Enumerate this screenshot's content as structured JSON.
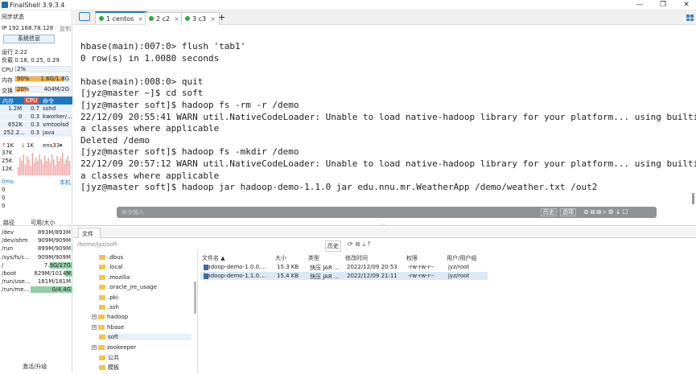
{
  "app": {
    "title": "FinalShell 3.9.3.4",
    "win_min": "—",
    "win_max": "❐",
    "win_close": "✕"
  },
  "sidebar": {
    "sync_status": "同步状态",
    "ip_label": "IP 192.168.78.128",
    "copy": "复制",
    "sysinfo_button": "系统信息",
    "uptime": "运行 2:22",
    "load": "负载 0.18, 0.25, 0.29",
    "cpu_label": "CPU",
    "cpu_value": "2%",
    "cpu_percent": 2,
    "mem_label": "内存",
    "mem_pct": "90%",
    "mem_percent": 90,
    "mem_value": "1.6G/1.8G",
    "swap_label": "交换",
    "swap_pct": "20%",
    "swap_percent": 20,
    "swap_value": "404M/2G",
    "proc_tabs": [
      "内存",
      "CPU",
      "命令"
    ],
    "processes": [
      {
        "mem": "1.2M",
        "cpu": "0.7",
        "cmd": "sshd"
      },
      {
        "mem": "0",
        "cpu": "0.3",
        "cmd": "kworker/..."
      },
      {
        "mem": "652K",
        "cpu": "0.3",
        "cmd": "vmtoolsd"
      },
      {
        "mem": "252.2...",
        "cpu": "0.3",
        "cmd": "java"
      }
    ],
    "net_up": "1K",
    "net_down": "1K",
    "net_iface": "ens33",
    "net_scale": [
      "37K",
      "25K",
      "12K"
    ],
    "latency_label": "0ms",
    "local_label": "本机",
    "latency_values": [
      "0",
      "0",
      "0"
    ],
    "disk_headers": [
      "路径",
      "可用/大小"
    ],
    "disks": [
      {
        "path": "/dev",
        "size": "893M/893M",
        "used": 0
      },
      {
        "path": "/dev/shm",
        "size": "909M/909M",
        "used": 0
      },
      {
        "path": "/run",
        "size": "899M/909M",
        "used": 1
      },
      {
        "path": "/sys/fs/c...",
        "size": "909M/909M",
        "used": 0
      },
      {
        "path": "/",
        "size": "7.9G/17G",
        "used": 54
      },
      {
        "path": "/boot",
        "size": "829M/1014M",
        "used": 18
      },
      {
        "path": "/run/use...",
        "size": "181M/181M",
        "used": 0
      },
      {
        "path": "/run/me...",
        "size": "0/4.4G",
        "used": 100
      }
    ],
    "upgrade": "激活/升级"
  },
  "tabs": [
    {
      "label": "1 centos"
    },
    {
      "label": "2 c2"
    },
    {
      "label": "3 c3"
    }
  ],
  "tab_add": "+",
  "terminal": {
    "lines": [
      "hbase(main):007:0> flush 'tab1'",
      "0 row(s) in 1.0080 seconds",
      "",
      "hbase(main):008:0> quit",
      "[jyz@master ~]$ cd soft",
      "[jyz@master soft]$ hadoop fs -rm -r /demo",
      "22/12/09 20:55:41 WARN util.NativeCodeLoader: Unable to load native-hadoop library for your platform... using builtin-jav",
      "a classes where applicable",
      "Deleted /demo",
      "[jyz@master soft]$ hadoop fs -mkdir /demo",
      "22/12/09 20:57:12 WARN util.NativeCodeLoader: Unable to load native-hadoop library for your platform... using builtin-jav",
      "a classes where applicable",
      "[jyz@master soft]$ hadoop jar hadoop-demo-1.1.0 jar edu.nnu.mr.WeatherApp /demo/weather.txt /out2"
    ],
    "cmd_placeholder": "命令输入",
    "history_btn": "历史",
    "options_btn": "选项"
  },
  "files": {
    "tab_label": "文件",
    "path": "/home/jyz/soft",
    "history_btn": "历史",
    "tree": [
      {
        "name": ".dbus",
        "expandable": false
      },
      {
        "name": ".local",
        "expandable": false
      },
      {
        "name": ".mozilla",
        "expandable": false
      },
      {
        "name": ".oracle_jre_usage",
        "expandable": false
      },
      {
        "name": ".pki",
        "expandable": false
      },
      {
        "name": ".ssh",
        "expandable": false
      },
      {
        "name": "hadoop",
        "expandable": true
      },
      {
        "name": "hbase",
        "expandable": true
      },
      {
        "name": "soft",
        "expandable": false
      },
      {
        "name": "zookeeper",
        "expandable": true
      },
      {
        "name": "公共",
        "expandable": false
      },
      {
        "name": "模板",
        "expandable": false
      }
    ],
    "columns": [
      "文件名 ▲",
      "大小",
      "类型",
      "修改时间",
      "权限",
      "用户/用户组"
    ],
    "rows": [
      {
        "name": "hadoop-demo-1.0.0....",
        "size": "15.3 KB",
        "type": "快压 JAR ...",
        "mtime": "2022/12/09 20:53",
        "perm": "-rw-rw-r--",
        "owner": "jyz/root"
      },
      {
        "name": "hadoop-demo-1.1.0....",
        "size": "15.4 KB",
        "type": "快压 JAR ...",
        "mtime": "2022/12/09 21:11",
        "perm": "-rw-rw-r--",
        "owner": "jyz/root"
      }
    ]
  },
  "colors": {
    "accent": "#1c78c0",
    "mem_bar": "#f3b24a",
    "disk_bar": "#8fd0a5",
    "net_chart": "#f0a0a0"
  }
}
